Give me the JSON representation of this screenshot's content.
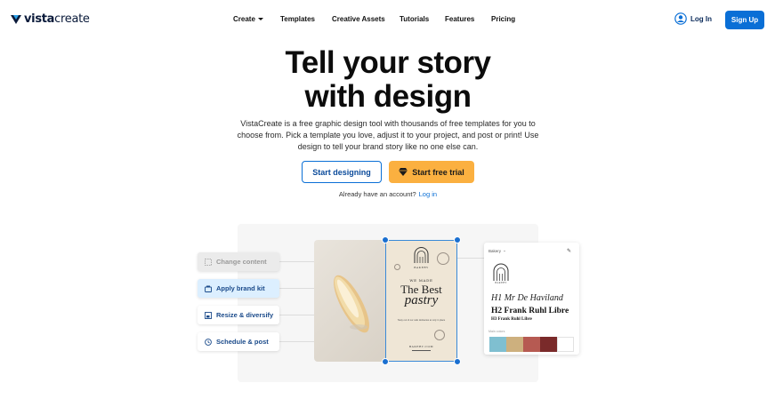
{
  "header": {
    "logo": {
      "bold": "vista",
      "light": "create"
    },
    "nav": [
      {
        "label": "Create",
        "has_caret": true
      },
      {
        "label": "Templates"
      },
      {
        "label": "Creative Assets"
      },
      {
        "label": "Tutorials"
      },
      {
        "label": "Features"
      },
      {
        "label": "Pricing"
      }
    ],
    "login_label": "Log In",
    "signup_label": "Sign Up"
  },
  "hero": {
    "title_line1": "Tell your story",
    "title_line2": "with design",
    "description": "VistaCreate is a free graphic design tool with thousands of free templates for you to choose from. Pick a template you love, adjust it to your project, and post or print! Use design to tell your brand story like no one else can.",
    "primary_cta": "Start designing",
    "secondary_cta": "Start free trial",
    "account_prompt": "Already have an account?",
    "account_link": "Log in"
  },
  "features": [
    {
      "label": "Change content",
      "icon": "change-content-icon"
    },
    {
      "label": "Apply brand kit",
      "icon": "brand-kit-icon"
    },
    {
      "label": "Resize & diversify",
      "icon": "resize-icon"
    },
    {
      "label": "Schedule & post",
      "icon": "clock-icon"
    }
  ],
  "design_preview": {
    "bakery": "BAKERY",
    "we_made": "WE MADE",
    "headline": "The Best",
    "script": "pastry",
    "small_text": "Tasty out of our cafe delicacies at only in place",
    "url": "BAKERY.COM"
  },
  "brand_panel": {
    "dropdown_label": "Bakery",
    "bakery_small": "BAKERY",
    "script_font": "H1 Mr De Haviland",
    "h2_font": "H2 Frank Ruhl Libre",
    "h3_font": "H3 Frank Ruhl Libre",
    "colors_label": "Main colors",
    "colors": [
      "#7fbfd0",
      "#cdb07e",
      "#b65a52",
      "#7a2a2a",
      "#ffffff"
    ]
  },
  "colors": {
    "accent_blue": "#0a6fd6",
    "accent_orange": "#fbb040"
  }
}
